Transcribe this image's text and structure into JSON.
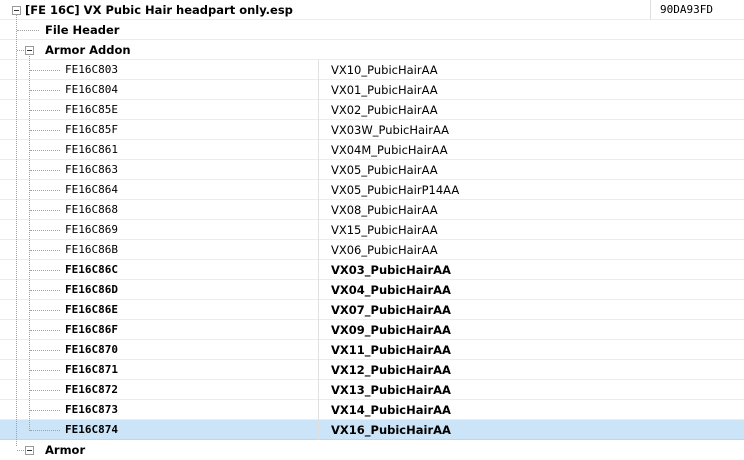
{
  "root": {
    "label": "[FE 16C] VX Pubic Hair headpart only.esp",
    "crc": "90DA93FD"
  },
  "file_header": {
    "label": "File Header"
  },
  "armor_addon": {
    "label": "Armor Addon",
    "items": [
      {
        "formid": "FE16C803",
        "edid": "VX10_PubicHairAA",
        "bold": false
      },
      {
        "formid": "FE16C804",
        "edid": "VX01_PubicHairAA",
        "bold": false
      },
      {
        "formid": "FE16C85E",
        "edid": "VX02_PubicHairAA",
        "bold": false
      },
      {
        "formid": "FE16C85F",
        "edid": "VX03W_PubicHairAA",
        "bold": false
      },
      {
        "formid": "FE16C861",
        "edid": "VX04M_PubicHairAA",
        "bold": false
      },
      {
        "formid": "FE16C863",
        "edid": "VX05_PubicHairAA",
        "bold": false
      },
      {
        "formid": "FE16C864",
        "edid": "VX05_PubicHairP14AA",
        "bold": false
      },
      {
        "formid": "FE16C868",
        "edid": "VX08_PubicHairAA",
        "bold": false
      },
      {
        "formid": "FE16C869",
        "edid": "VX15_PubicHairAA",
        "bold": false
      },
      {
        "formid": "FE16C86B",
        "edid": "VX06_PubicHairAA",
        "bold": false
      },
      {
        "formid": "FE16C86C",
        "edid": "VX03_PubicHairAA",
        "bold": true
      },
      {
        "formid": "FE16C86D",
        "edid": "VX04_PubicHairAA",
        "bold": true
      },
      {
        "formid": "FE16C86E",
        "edid": "VX07_PubicHairAA",
        "bold": true
      },
      {
        "formid": "FE16C86F",
        "edid": "VX09_PubicHairAA",
        "bold": true
      },
      {
        "formid": "FE16C870",
        "edid": "VX11_PubicHairAA",
        "bold": true
      },
      {
        "formid": "FE16C871",
        "edid": "VX12_PubicHairAA",
        "bold": true
      },
      {
        "formid": "FE16C872",
        "edid": "VX13_PubicHairAA",
        "bold": true
      },
      {
        "formid": "FE16C873",
        "edid": "VX14_PubicHairAA",
        "bold": true
      },
      {
        "formid": "FE16C874",
        "edid": "VX16_PubicHairAA",
        "bold": true,
        "selected": true
      }
    ]
  },
  "next_group": {
    "label": "Armor"
  },
  "colors": {
    "selected_row": "#cce4f7",
    "tree_lines": "#a0a0a0"
  }
}
